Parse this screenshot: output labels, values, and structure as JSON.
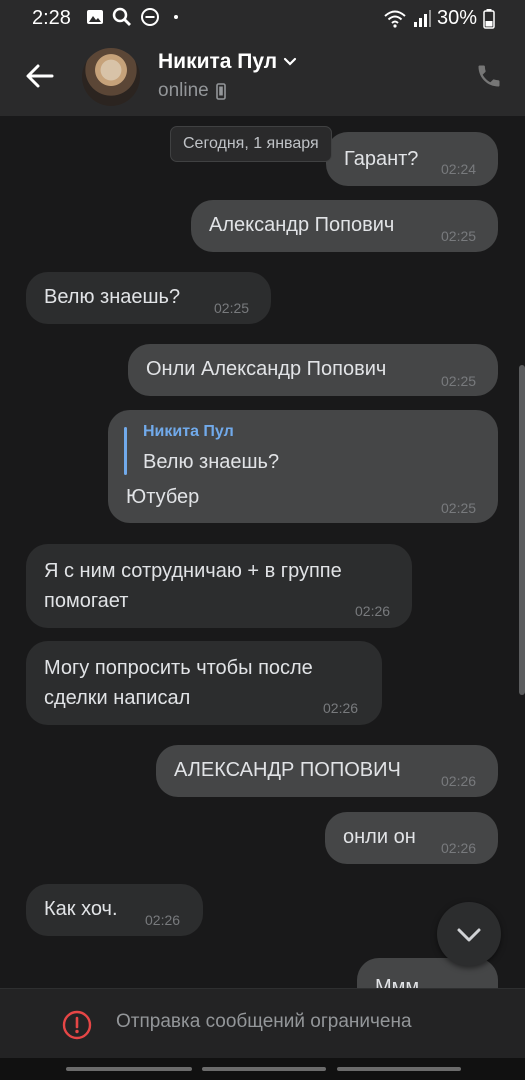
{
  "status_bar": {
    "time": "2:28",
    "battery": "30%",
    "icons": [
      "gallery-icon",
      "search-icon",
      "do-not-disturb-icon",
      "dot-icon",
      "wifi-icon",
      "signal-icon",
      "battery-icon"
    ]
  },
  "header": {
    "name": "Никита Пул",
    "presence": "online",
    "icons": [
      "back-arrow-icon",
      "chevron-down-icon",
      "mobile-icon",
      "phone-icon"
    ]
  },
  "chat": {
    "date_separator": "Сегодня, 1 января",
    "messages": [
      {
        "dir": "out",
        "text": "Гарант?",
        "time": "02:24"
      },
      {
        "dir": "out",
        "text": "Александр Попович",
        "time": "02:25"
      },
      {
        "dir": "in",
        "text": "Велю знаешь?",
        "time": "02:25"
      },
      {
        "dir": "out",
        "text": "Онли Александр Попович",
        "time": "02:25"
      },
      {
        "dir": "out",
        "reply_author": "Никита Пул",
        "reply_text": "Велю знаешь?",
        "text": "Ютубер",
        "time": "02:25"
      },
      {
        "dir": "in",
        "line1": "Я с ним сотрудничаю + в группе",
        "line2": "помогает",
        "time": "02:26"
      },
      {
        "dir": "in",
        "line1": "Могу попросить чтобы после",
        "line2": "сделки написал",
        "time": "02:26"
      },
      {
        "dir": "out",
        "text": "АЛЕКСАНДР ПОПОВИЧ",
        "time": "02:26"
      },
      {
        "dir": "out",
        "text": "онли он",
        "time": "02:26"
      },
      {
        "dir": "in",
        "text": "Как хоч.",
        "time": "02:26"
      },
      {
        "dir": "out",
        "text": "Ммм"
      }
    ]
  },
  "restriction": {
    "text": "Отправка сообщений ограничена",
    "icon": "warning-circle-icon",
    "color": "#e64646"
  },
  "colors": {
    "background": "#19191a",
    "incoming_bubble": "#2c2d2e",
    "outgoing_bubble": "#454647",
    "accent": "#71aaeb"
  }
}
